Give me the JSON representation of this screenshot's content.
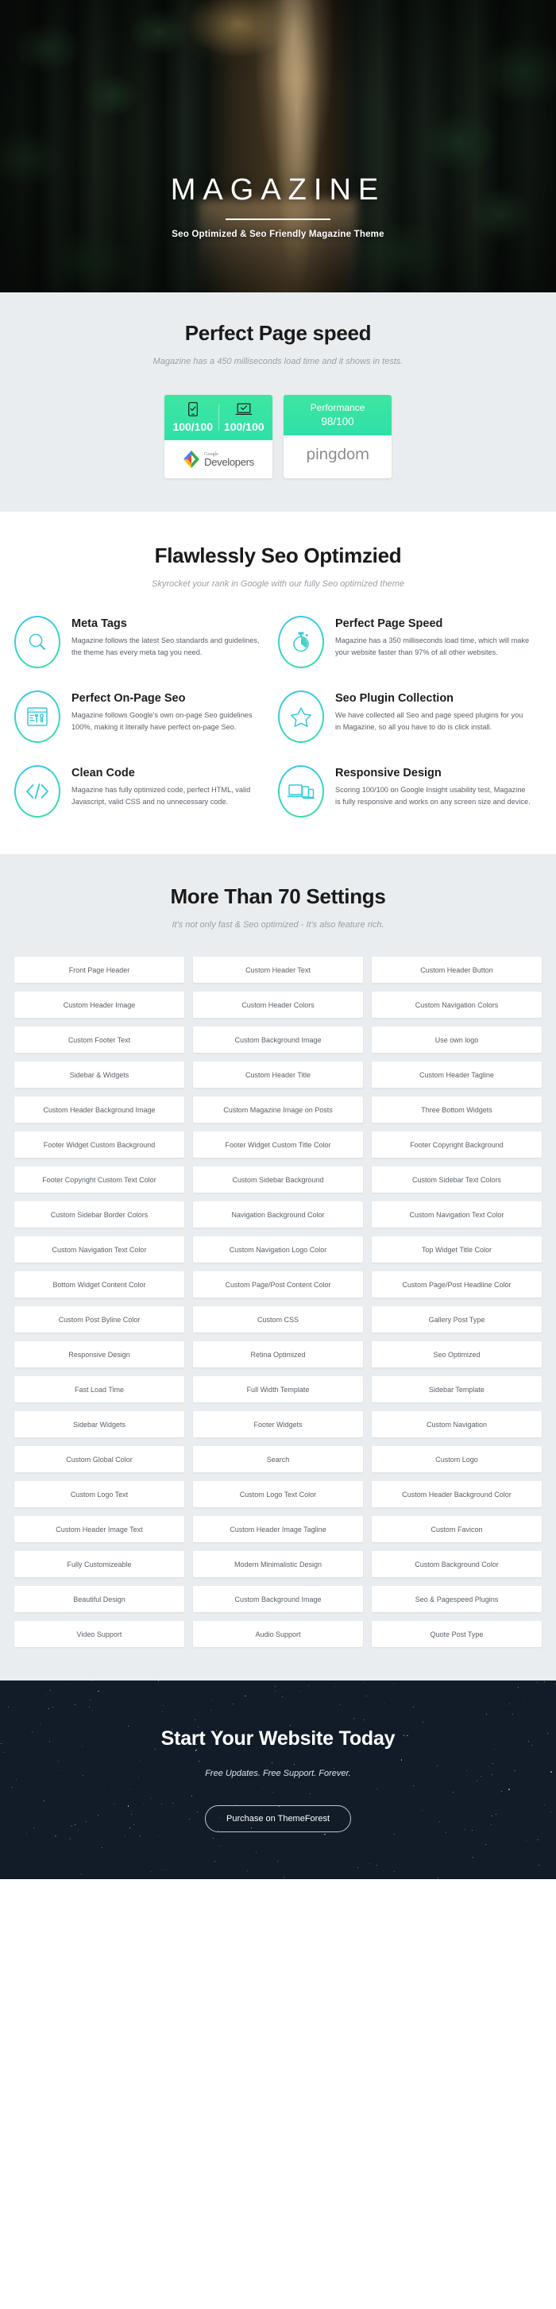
{
  "hero": {
    "title": "MAGAZINE",
    "subtitle": "Seo Optimized & Seo Friendly Magazine Theme"
  },
  "speed": {
    "title": "Perfect Page speed",
    "subtitle": "Magazine has a 450 milliseconds load time and it shows in tests.",
    "google_card": {
      "mobile_icon": "mobile-check-icon",
      "mobile_score": "100/100",
      "desktop_icon": "laptop-check-icon",
      "desktop_score": "100/100",
      "brand_small": "Google",
      "brand_big": "Developers"
    },
    "pingdom_card": {
      "label": "Performance",
      "score": "98/100",
      "brand": "pingdom"
    }
  },
  "seo": {
    "title": "Flawlessly Seo Optimzied",
    "subtitle": "Skyrocket your rank in Google with our fully Seo optimized theme",
    "features": [
      {
        "icon": "magnifier-icon",
        "title": "Meta Tags",
        "desc": "Magazine follows the latest Seo standards and guidelines, the theme has every meta tag you need."
      },
      {
        "icon": "stopwatch-icon",
        "title": "Perfect Page Speed",
        "desc": "Magazine has a 350 milliseconds load time, which will make your website faster than 97% of all other websites."
      },
      {
        "icon": "browser-tools-icon",
        "title": "Perfect On-Page Seo",
        "desc": "Magazine follows Google's own on-page Seo guidelines 100%, making it literally have perfect on-page Seo."
      },
      {
        "icon": "star-icon",
        "title": "Seo Plugin Collection",
        "desc": "We have collected all Seo and page speed plugins for you in Magazine, so all you have to do is click install."
      },
      {
        "icon": "code-brackets-icon",
        "title": "Clean Code",
        "desc": "Magazine has fully optimized code, perfect HTML, valid Javascript, valid CSS and no unnecessary code."
      },
      {
        "icon": "devices-icon",
        "title": "Responsive Design",
        "desc": "Scoring 100/100 on Google Insight usability test, Magazine is fully responsive and works on any screen size and device."
      }
    ]
  },
  "settings": {
    "title": "More Than 70 Settings",
    "subtitle": "It's not only fast & Seo optimized - It's also feature rich.",
    "items": [
      "Front Page Header",
      "Custom Header Text",
      "Custom Header Button",
      "Custom Header Image",
      "Custom Header Colors",
      "Custom Navigation Colors",
      "Custom Footer Text",
      "Custom Background Image",
      "Use own logo",
      "Sidebar & Widgets",
      "Custom Header Title",
      "Custom Header Tagline",
      "Custom Header Background Image",
      "Custom Magazine Image on Posts",
      "Three Bottom Widgets",
      "Footer Widget Custom Background",
      "Footer Widget Custom Title Color",
      "Footer Copyright Background",
      "Footer Copyright Custom Text Color",
      "Custom Sidebar Background",
      "Custom Sidebar Text Colors",
      "Custom Sidebar Border Colors",
      "Navigation Background Color",
      "Custom Navigation Text Color",
      "Custom Navigation Text Color",
      "Custom Navigation Logo Color",
      "Top Widget Title Color",
      "Bottom Widget Content Color",
      "Custom Page/Post Content Color",
      "Custom Page/Post Headline Color",
      "Custom Post Byline Color",
      "Custom CSS",
      "Gallery Post Type",
      "Responsive Design",
      "Retina Optimized",
      "Seo Optimized",
      "Fast Load Time",
      "Full Width Template",
      "Sidebar Template",
      "Sidebar Widgets",
      "Footer Widgets",
      "Custom Navigation",
      "Custom Global Color",
      "Search",
      "Custom Logo",
      "Custom Logo Text",
      "Custom Logo Text Color",
      "Custom Header Background Color",
      "Custom Header Image Text",
      "Custom Header Image Tagline",
      "Custom Favicon",
      "Fully Customizeable",
      "Modern Minimalistic Design",
      "Custom Background Color",
      "Beautiful Design",
      "Custom Background Image",
      "Seo & Pagespeed Plugins",
      "Video Support",
      "Audio Support",
      "Quote Post Type"
    ]
  },
  "cta": {
    "title": "Start Your Website Today",
    "subtitle": "Free Updates. Free Support. Forever.",
    "button_label": "Purchase on ThemeForest"
  },
  "colors": {
    "accent_green": "#35e0a1",
    "icon_gradient_start": "#3ec6f0",
    "icon_gradient_end": "#3be09a",
    "section_gray": "#eaedf0",
    "cta_background": "#111c28"
  }
}
